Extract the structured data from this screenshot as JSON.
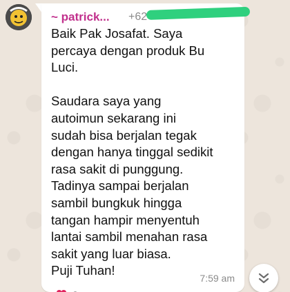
{
  "chat": {
    "sender": {
      "name": "~ patrick...",
      "phone_visible": "+62",
      "name_color": "#c12f8c",
      "avatar": "contact-avatar"
    },
    "message": {
      "lines": [
        "Baik Pak Josafat. Saya",
        "percaya dengan produk Bu",
        "Luci.",
        "",
        "Saudara saya yang",
        "autoimun sekarang ini",
        "sudah bisa berjalan tegak",
        "dengan hanya tinggal sedikit",
        "rasa sakit di punggung.",
        "Tadinya sampai berjalan",
        "sambil bungkuk hingga",
        "tangan hampir menyentuh",
        "lantai sambil menahan rasa",
        "sakit yang luar biasa.",
        "Puji Tuhan!"
      ],
      "time": "7:59 am"
    },
    "scroll_down_icon": "double-chevron-down-icon",
    "redaction_color": "#2fd07e"
  }
}
